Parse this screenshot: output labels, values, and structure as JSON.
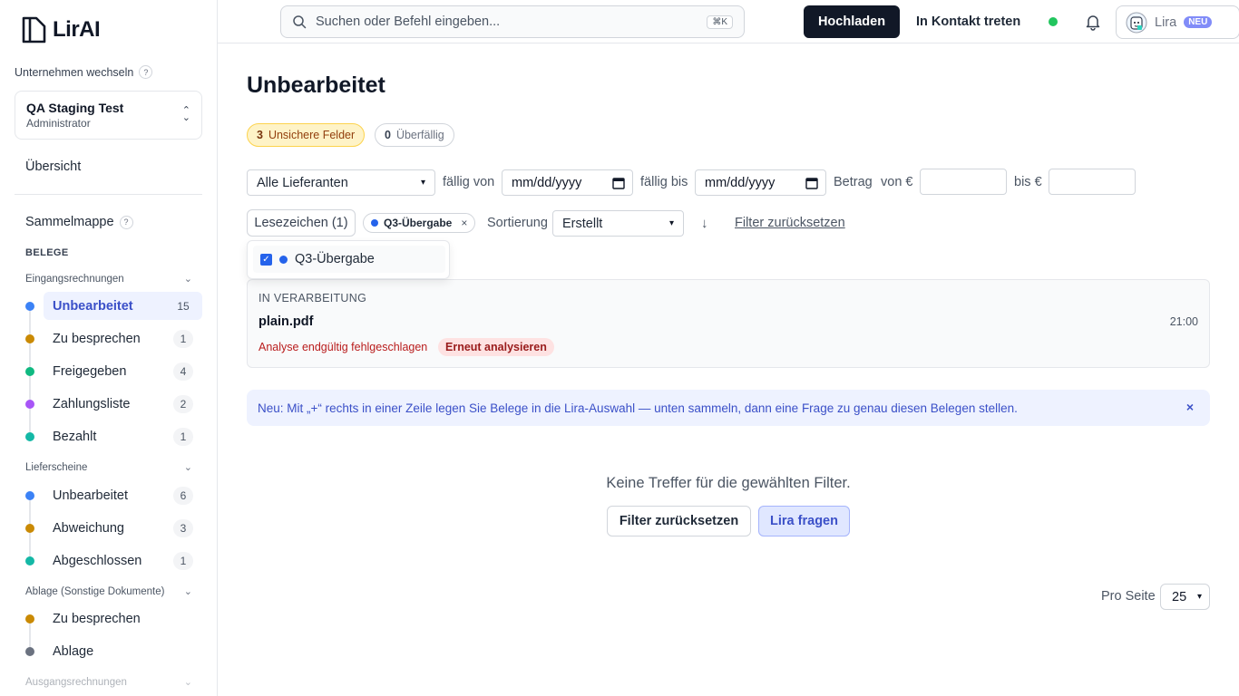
{
  "app": {
    "logo_text": "LirAI"
  },
  "sidebar": {
    "switch_label": "Unternehmen wechseln",
    "help": "?",
    "company": {
      "name": "QA Staging Test",
      "role": "Administrator"
    },
    "overview": "Übersicht",
    "sammelmappe": "Sammelmappe",
    "section_title": "BELEGE",
    "groups": [
      {
        "title": "Eingangsrechnungen",
        "items": [
          {
            "label": "Unbearbeitet",
            "count": "15",
            "color": "#3b82f6",
            "active": true
          },
          {
            "label": "Zu besprechen",
            "count": "1",
            "color": "#ca8a04"
          },
          {
            "label": "Freigegeben",
            "count": "4",
            "color": "#10b981"
          },
          {
            "label": "Zahlungsliste",
            "count": "2",
            "color": "#a855f7"
          },
          {
            "label": "Bezahlt",
            "count": "1",
            "color": "#14b8a6"
          }
        ]
      },
      {
        "title": "Lieferscheine",
        "items": [
          {
            "label": "Unbearbeitet",
            "count": "6",
            "color": "#3b82f6"
          },
          {
            "label": "Abweichung",
            "count": "3",
            "color": "#ca8a04"
          },
          {
            "label": "Abgeschlossen",
            "count": "1",
            "color": "#14b8a6"
          }
        ]
      },
      {
        "title": "Ablage (Sonstige Dokumente)",
        "items": [
          {
            "label": "Zu besprechen",
            "color": "#ca8a04"
          },
          {
            "label": "Ablage",
            "color": "#6b7280"
          }
        ]
      },
      {
        "title": "Ausgangsrechnungen",
        "items": []
      }
    ]
  },
  "header": {
    "search_placeholder": "Suchen oder Befehl eingeben...",
    "search_shortcut": "⌘K",
    "upload_label": "Hochladen",
    "contact_label": "In Kontakt treten",
    "lira_label": "Lira",
    "lira_badge": "NEU"
  },
  "main": {
    "title": "Unbearbeitet",
    "chips": {
      "uncertain_count": "3",
      "uncertain_label": "Unsichere Felder",
      "overdue_count": "0",
      "overdue_label": "Überfällig"
    },
    "filters": {
      "supplier": "Alle Lieferanten",
      "due_from_label": "fällig von",
      "due_from_placeholder": "mm/dd/yyyy",
      "due_to_label": "fällig bis",
      "due_to_placeholder": "mm/dd/yyyy",
      "amount_label": "Betrag",
      "amount_from_label": "von €",
      "amount_to_label": "bis €",
      "bookmarks_label": "Lesezeichen (1)",
      "active_tag": "Q3-Übergabe",
      "tag_remove": "×",
      "sort_label": "Sortierung",
      "sort_value": "Erstellt",
      "sort_direction": "↓",
      "reset_label": "Filter zurücksetzen"
    },
    "bookmark_dropdown": {
      "item_label": "Q3-Übergabe",
      "checked": true
    },
    "processing_card": {
      "status": "IN VERARBEITUNG",
      "file": "plain.pdf",
      "time": "21:00",
      "error": "Analyse endgültig fehlgeschlagen",
      "retry_label": "Erneut analysieren"
    },
    "info_banner": {
      "text": "Neu: Mit „+“ rechts in einer Zeile legen Sie Belege in die Lira-Auswahl — unten sammeln, dann eine Frage zu genau diesen Belegen stellen.",
      "close": "×"
    },
    "empty_state": {
      "message": "Keine Treffer für die gewählten Filter.",
      "reset_label": "Filter zurücksetzen",
      "ask_label": "Lira fragen"
    },
    "pagination": {
      "per_page_label": "Pro Seite",
      "per_page_value": "25"
    }
  },
  "colors": {
    "accent": "#3b50c8",
    "primary_button": "#111827",
    "online": "#22c55e"
  }
}
